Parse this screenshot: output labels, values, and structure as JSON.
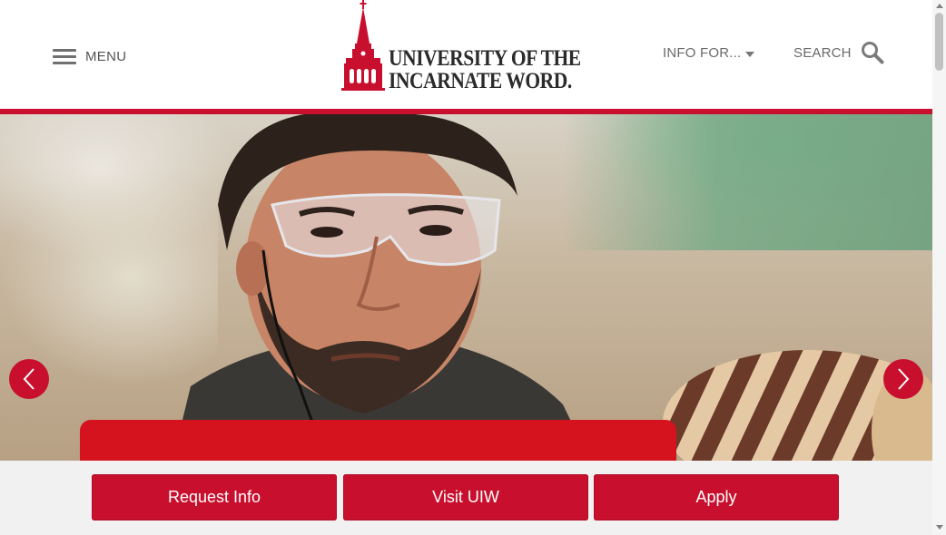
{
  "header": {
    "menu_label": "MENU",
    "logo_line1": "UNIVERSITY OF THE",
    "logo_line2": "INCARNATE WORD.",
    "info_for_label": "INFO FOR...",
    "search_label": "SEARCH"
  },
  "hero": {
    "prev_icon": "chevron-left-icon",
    "next_icon": "chevron-right-icon"
  },
  "cta": {
    "request_info": "Request Info",
    "visit": "Visit UIW",
    "apply": "Apply"
  },
  "colors": {
    "brand_red": "#c8102e",
    "cta_bar_bg": "#f1f1f1"
  }
}
